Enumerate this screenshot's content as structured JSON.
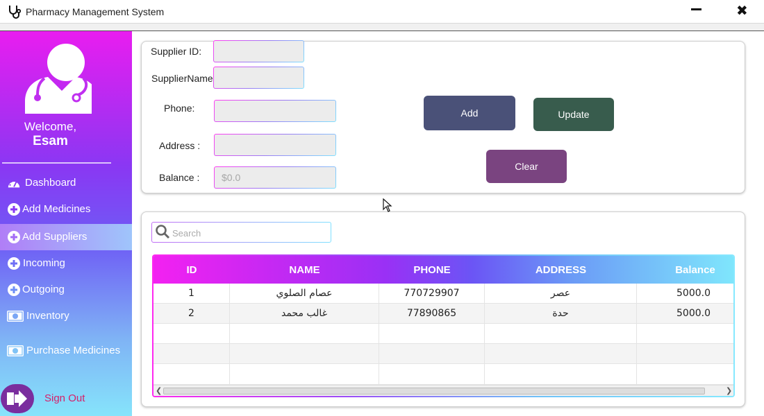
{
  "window": {
    "title": "Pharmacy Management System",
    "close_glyph": "✖"
  },
  "sidebar": {
    "welcome": "Welcome,",
    "username": "Esam",
    "items": [
      {
        "label": "Dashboard",
        "icon": "dashboard-gauge-icon"
      },
      {
        "label": "Add Medicines",
        "icon": "plus-circle-icon"
      },
      {
        "label": "Add Suppliers",
        "icon": "plus-circle-icon",
        "active": true
      },
      {
        "label": "Incoming",
        "icon": "plus-circle-icon"
      },
      {
        "label": "Outgoing",
        "icon": "plus-circle-icon"
      },
      {
        "label": "Inventory",
        "icon": "money-bill-icon"
      },
      {
        "label": "Purchase Medicines",
        "icon": "money-bill-icon"
      }
    ],
    "sign_out": "Sign Out"
  },
  "form": {
    "supplier_id_label": "Supplier ID:",
    "supplier_name_label": "SupplierName",
    "phone_label": "Phone:",
    "address_label": "Address :",
    "balance_label": "Balance :",
    "supplier_id_value": "",
    "supplier_name_value": "",
    "phone_value": "",
    "address_value": "",
    "balance_placeholder": "$0.0"
  },
  "buttons": {
    "add": "Add",
    "update": "Update",
    "clear": "Clear"
  },
  "colors": {
    "add_button": "#4a5178",
    "update_button": "#385c4d",
    "clear_button": "#7a4480",
    "sign_out_text": "#d6206a"
  },
  "search": {
    "placeholder": "Search"
  },
  "table": {
    "columns": [
      "ID",
      "NAME",
      "PHONE",
      "ADDRESS",
      "Balance"
    ],
    "rows": [
      [
        "1",
        "عصام الصلوي",
        "770729907",
        "عصر",
        "5000.0"
      ],
      [
        "2",
        "غالب محمد",
        "77890865",
        "حدة",
        "5000.0"
      ]
    ]
  }
}
